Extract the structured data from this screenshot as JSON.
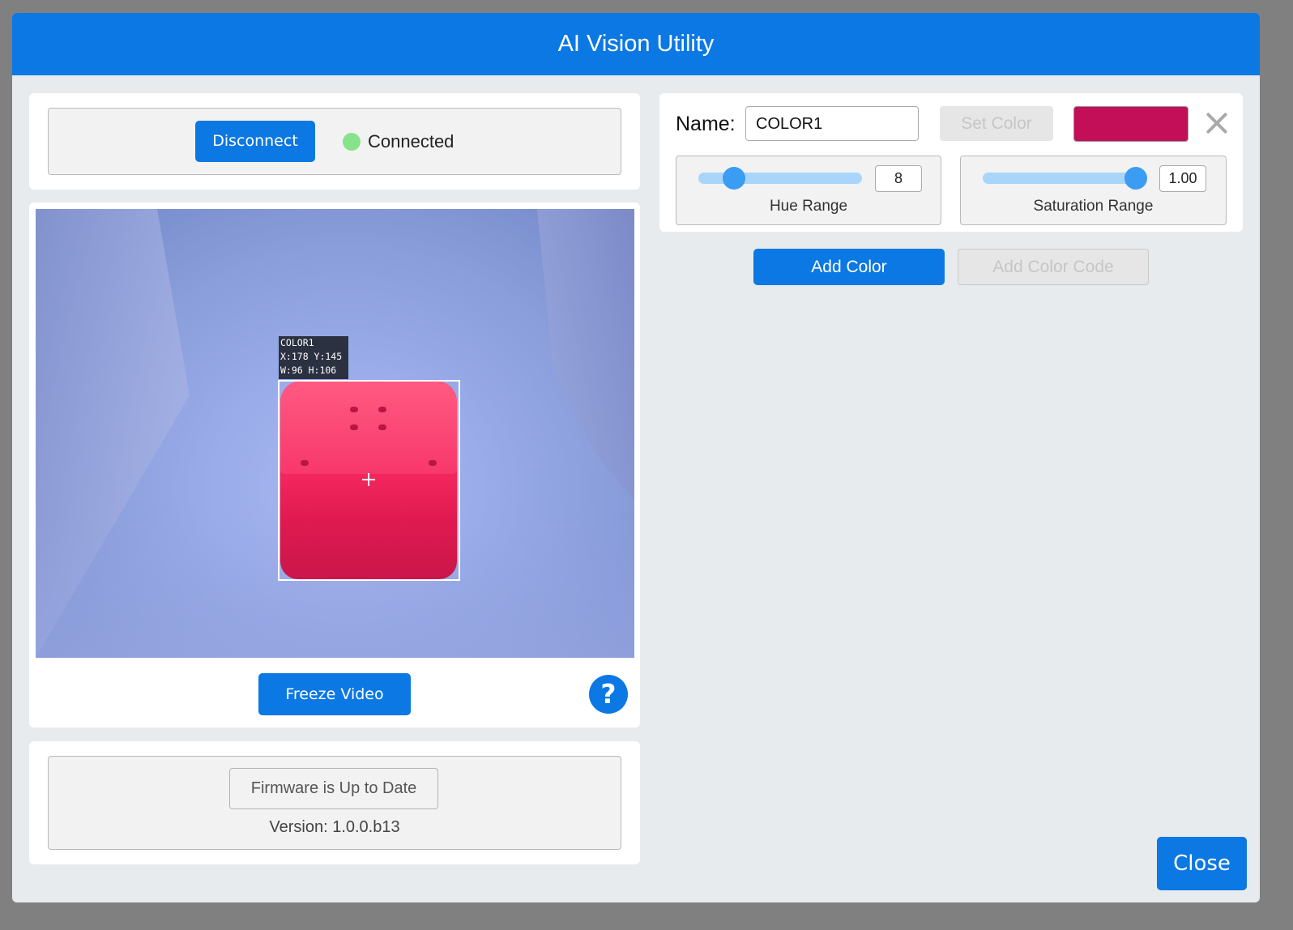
{
  "window": {
    "title": "AI Vision Utility"
  },
  "connection": {
    "button_label": "Disconnect",
    "status": "Connected",
    "status_color": "#86e38a"
  },
  "video": {
    "detection": {
      "name": "COLOR1",
      "coords": "X:178 Y:145",
      "size": "W:96 H:106"
    },
    "freeze_label": "Freeze Video",
    "help_icon": "?"
  },
  "firmware": {
    "status_label": "Firmware is Up to Date",
    "version": "Version: 1.0.0.b13"
  },
  "color_panel": {
    "name_label": "Name:",
    "name_value": "COLOR1",
    "set_color_label": "Set Color",
    "swatch_color": "#c20f58",
    "hue": {
      "label": "Hue Range",
      "value": "8"
    },
    "saturation": {
      "label": "Saturation Range",
      "value": "1.00"
    }
  },
  "actions": {
    "add_color": "Add Color",
    "add_color_code": "Add Color Code",
    "close": "Close"
  },
  "colors": {
    "accent": "#0b78e3"
  }
}
